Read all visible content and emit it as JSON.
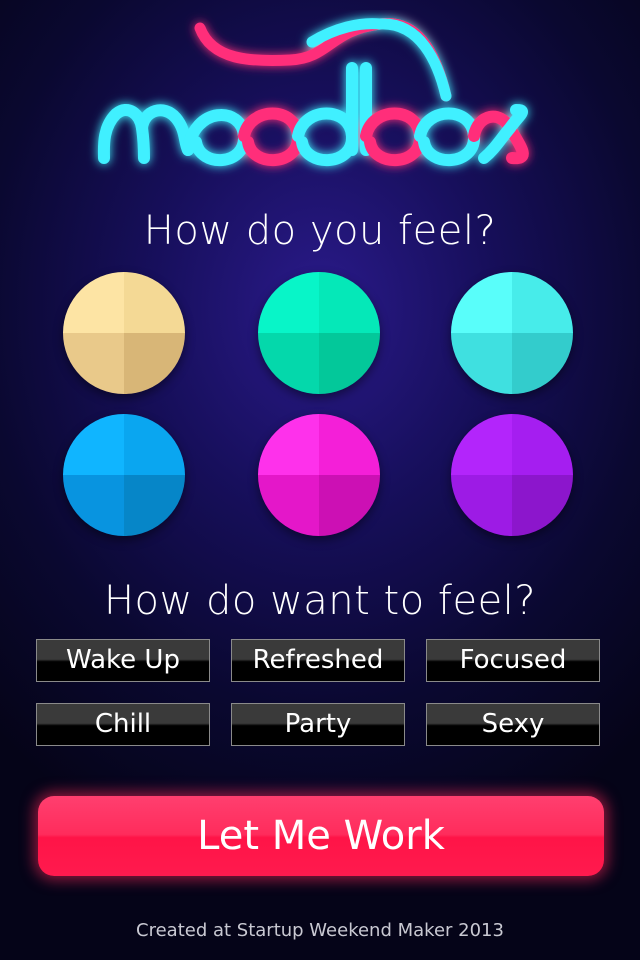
{
  "app": {
    "logo_text": "moodbox"
  },
  "mood_section": {
    "title": "How do you feel?",
    "moods": [
      {
        "id": "mood-sand",
        "colors": [
          "#fde4a4",
          "#f4d995",
          "#e9c98a",
          "#d8b677"
        ]
      },
      {
        "id": "mood-green",
        "colors": [
          "#08f5c8",
          "#05e8b8",
          "#04d8ab",
          "#03c89a"
        ]
      },
      {
        "id": "mood-aqua",
        "colors": [
          "#59fefa",
          "#47ecea",
          "#3fe0e0",
          "#33cccc"
        ]
      },
      {
        "id": "mood-blue",
        "colors": [
          "#10b5ff",
          "#0aa6f0",
          "#0894e0",
          "#0686c8"
        ]
      },
      {
        "id": "mood-pink",
        "colors": [
          "#fe31eb",
          "#f41fd8",
          "#e417c9",
          "#cc10b4"
        ]
      },
      {
        "id": "mood-purple",
        "colors": [
          "#b325fb",
          "#a51ef0",
          "#9d1be5",
          "#8c16cc"
        ]
      }
    ]
  },
  "goal_section": {
    "title": "How do want to feel?",
    "options": [
      "Wake Up",
      "Refreshed",
      "Focused",
      "Chill",
      "Party",
      "Sexy"
    ]
  },
  "cta": {
    "label": "Let Me Work"
  },
  "footer": {
    "text": "Created at Startup Weekend Maker 2013"
  },
  "colors": {
    "neon_cyan": "#3ff0ff",
    "neon_pink": "#ff2d7a",
    "cta": "#ff2c5c"
  }
}
